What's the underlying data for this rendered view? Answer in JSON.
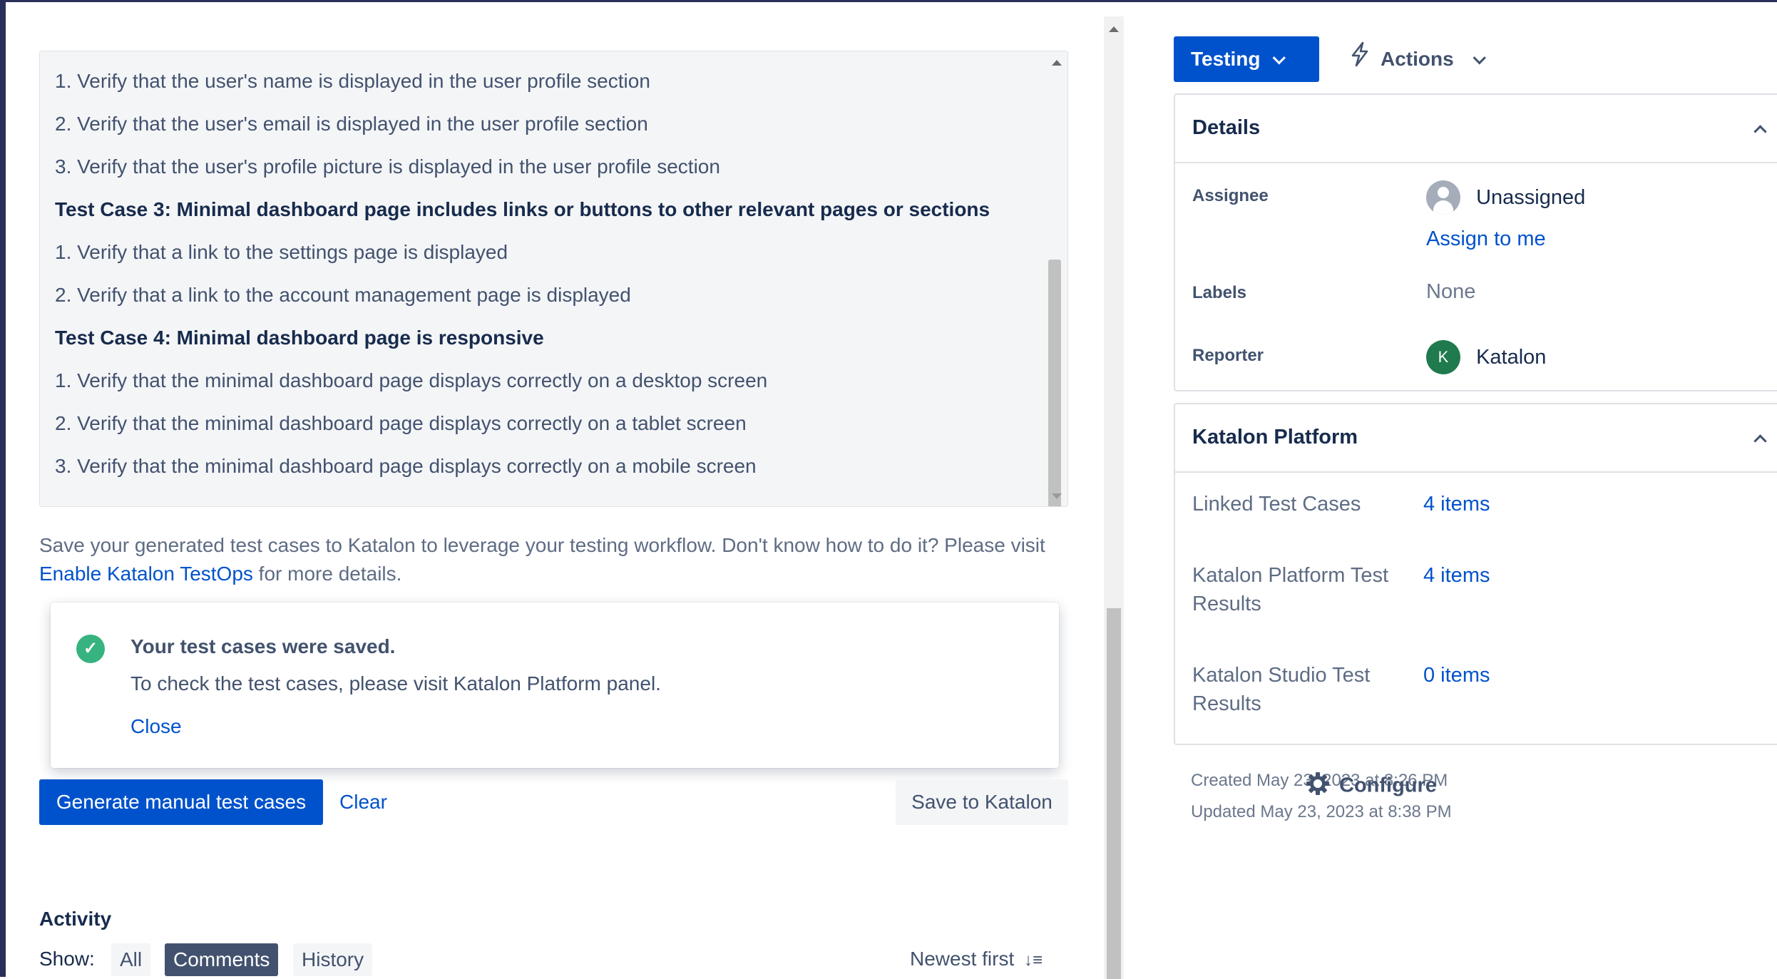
{
  "description": {
    "lines": [
      {
        "text": "1. Verify that the user's name is displayed in the user profile section",
        "bold": false
      },
      {
        "text": "2. Verify that the user's email is displayed in the user profile section",
        "bold": false
      },
      {
        "text": "3. Verify that the user's profile picture is displayed in the user profile section",
        "bold": false
      },
      {
        "text": "Test Case 3: Minimal dashboard page includes links or buttons to other relevant pages or sections",
        "bold": true
      },
      {
        "text": "1. Verify that a link to the settings page is displayed",
        "bold": false
      },
      {
        "text": "2. Verify that a link to the account management page is displayed",
        "bold": false
      },
      {
        "text": "Test Case 4: Minimal dashboard page is responsive",
        "bold": true
      },
      {
        "text": "1. Verify that the minimal dashboard page displays correctly on a desktop screen",
        "bold": false
      },
      {
        "text": "2. Verify that the minimal dashboard page displays correctly on a tablet screen",
        "bold": false
      },
      {
        "text": "3. Verify that the minimal dashboard page displays correctly on a mobile screen",
        "bold": false
      }
    ]
  },
  "help": {
    "text_before": "Save your generated test cases to Katalon to leverage your testing workflow. Don't know how to do it? Please visit ",
    "link": "Enable Katalon TestOps",
    "text_after": " for more details."
  },
  "flag": {
    "title": "Your test cases were saved.",
    "description": "To check the test cases, please visit Katalon Platform panel.",
    "close": "Close"
  },
  "buttons": {
    "generate": "Generate manual test cases",
    "clear": "Clear",
    "save": "Save to Katalon"
  },
  "activity": {
    "heading": "Activity",
    "show_label": "Show:",
    "filters": [
      {
        "label": "All",
        "active": false
      },
      {
        "label": "Comments",
        "active": true
      },
      {
        "label": "History",
        "active": false
      }
    ],
    "sort": "Newest first"
  },
  "header": {
    "status": "Testing",
    "actions": "Actions"
  },
  "details": {
    "title": "Details",
    "assignee_label": "Assignee",
    "assignee_value": "Unassigned",
    "assign_to_me": "Assign to me",
    "labels_label": "Labels",
    "labels_value": "None",
    "reporter_label": "Reporter",
    "reporter_initial": "K",
    "reporter_value": "Katalon"
  },
  "katalon_platform": {
    "title": "Katalon Platform",
    "rows": [
      {
        "label": "Linked Test Cases",
        "value": "4 items"
      },
      {
        "label": "Katalon Platform Test Results",
        "value": "4 items"
      },
      {
        "label": "Katalon Studio Test Results",
        "value": "0 items"
      }
    ]
  },
  "meta": {
    "created": "Created May 23, 2023 at 8:26 PM",
    "updated": "Updated May 23, 2023 at 8:38 PM",
    "configure": "Configure"
  },
  "colors": {
    "primary": "#0052cc",
    "success": "#36b37e",
    "text": "#172b4d",
    "subtle": "#42526e"
  }
}
